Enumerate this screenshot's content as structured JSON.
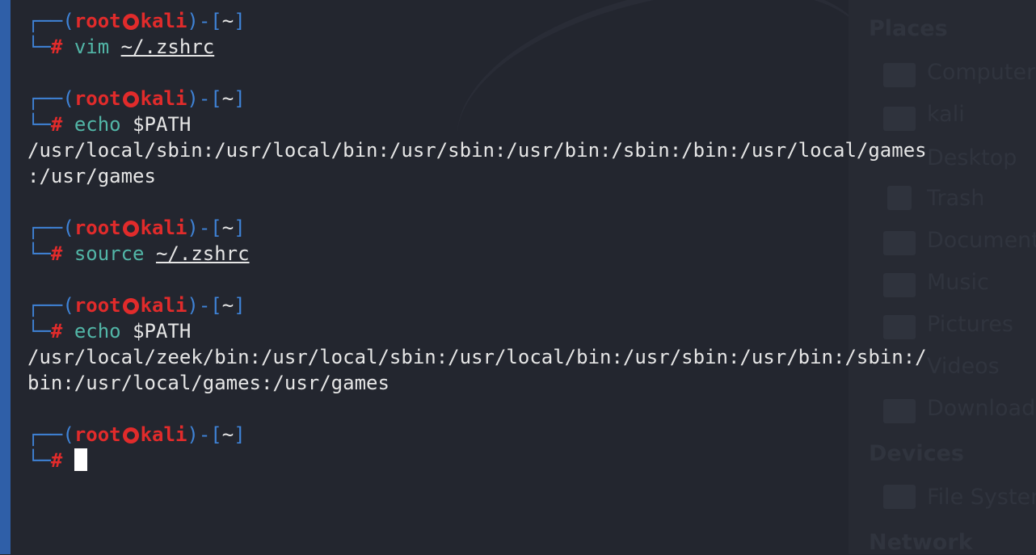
{
  "prompt": {
    "user": "root",
    "host": "kali",
    "dir": "~",
    "symbol": "#",
    "open_paren": "(",
    "close_paren": ")",
    "bracket_open": "-[",
    "bracket_close": "]",
    "corner_top": "┌──",
    "corner_bottom": "└─"
  },
  "history": [
    {
      "cmd": "vim",
      "arg": "~/.zshrc"
    },
    {
      "cmd": "echo",
      "arg": "$PATH",
      "output": [
        "/usr/local/sbin:/usr/local/bin:/usr/sbin:/usr/bin:/sbin:/bin:/usr/local/games",
        ":/usr/games"
      ]
    },
    {
      "cmd": "source",
      "arg": "~/.zshrc"
    },
    {
      "cmd": "echo",
      "arg": "$PATH",
      "output": [
        "/usr/local/zeek/bin:/usr/local/sbin:/usr/local/bin:/usr/sbin:/usr/bin:/sbin:/",
        "bin:/usr/local/games:/usr/games"
      ]
    }
  ],
  "file_manager": {
    "places_heading": "Places",
    "places": [
      "Computer",
      "kali",
      "Desktop",
      "Trash",
      "Documents",
      "Music",
      "Pictures",
      "Videos",
      "Downloads"
    ],
    "devices_heading": "Devices",
    "devices": [
      "File System"
    ],
    "network_heading": "Network"
  },
  "colors": {
    "background": "#23262f",
    "prompt_blue": "#3f83d7",
    "prompt_red": "#e12b2b",
    "command_teal": "#52b6a7",
    "text": "#e6e6e6"
  }
}
